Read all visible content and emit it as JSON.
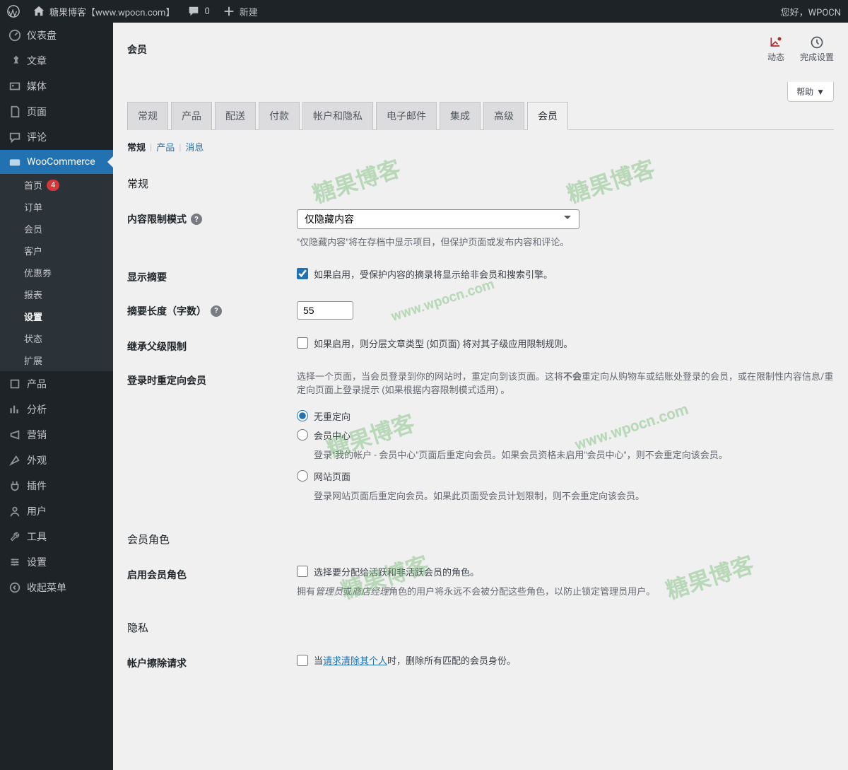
{
  "adminBar": {
    "siteName": "糖果博客【www.wpocn.com】",
    "commentCount": "0",
    "newLabel": "新建",
    "greeting": "您好，WPOCN"
  },
  "sidebar": {
    "items": [
      {
        "label": "仪表盘",
        "icon": "dashboard"
      },
      {
        "label": "文章",
        "icon": "pin"
      },
      {
        "label": "媒体",
        "icon": "media"
      },
      {
        "label": "页面",
        "icon": "page"
      },
      {
        "label": "评论",
        "icon": "comment"
      },
      {
        "label": "WooCommerce",
        "icon": "woo",
        "active": true
      },
      {
        "label": "产品",
        "icon": "product"
      },
      {
        "label": "分析",
        "icon": "analytics"
      },
      {
        "label": "营销",
        "icon": "marketing"
      },
      {
        "label": "外观",
        "icon": "appearance"
      },
      {
        "label": "插件",
        "icon": "plugins"
      },
      {
        "label": "用户",
        "icon": "users"
      },
      {
        "label": "工具",
        "icon": "tools"
      },
      {
        "label": "设置",
        "icon": "settings"
      },
      {
        "label": "收起菜单",
        "icon": "collapse"
      }
    ],
    "submenu": [
      {
        "label": "首页",
        "badge": "4"
      },
      {
        "label": "订单"
      },
      {
        "label": "会员"
      },
      {
        "label": "客户"
      },
      {
        "label": "优惠券"
      },
      {
        "label": "报表"
      },
      {
        "label": "设置",
        "current": true
      },
      {
        "label": "状态"
      },
      {
        "label": "扩展"
      }
    ]
  },
  "header": {
    "title": "会员",
    "actions": [
      {
        "label": "动态"
      },
      {
        "label": "完成设置"
      }
    ],
    "helpLabel": "帮助"
  },
  "tabs": [
    {
      "label": "常规"
    },
    {
      "label": "产品"
    },
    {
      "label": "配送"
    },
    {
      "label": "付款"
    },
    {
      "label": "帐户和隐私"
    },
    {
      "label": "电子邮件"
    },
    {
      "label": "集成"
    },
    {
      "label": "高级"
    },
    {
      "label": "会员",
      "active": true
    }
  ],
  "subtabs": [
    {
      "label": "常规",
      "active": true
    },
    {
      "label": "产品"
    },
    {
      "label": "消息"
    }
  ],
  "sections": {
    "general": {
      "title": "常规",
      "restrictMode": {
        "label": "内容限制模式",
        "value": "仅隐藏内容",
        "desc": "\"仅隐藏内容\"将在存档中显示项目，但保护页面或发布内容和评论。"
      },
      "showExcerpt": {
        "label": "显示摘要",
        "text": "如果启用，受保护内容的摘录将显示给非会员和搜索引擎。",
        "checked": true
      },
      "excerptLength": {
        "label": "摘要长度（字数）",
        "value": "55"
      },
      "inherit": {
        "label": "继承父级限制",
        "text": "如果启用，则分层文章类型 (如页面) 将对其子级应用限制规则。",
        "checked": false
      },
      "redirect": {
        "label": "登录时重定向会员",
        "intro1": "选择一个页面，当会员登录到你的网站时，重定向到该页面。这将",
        "introBold": "不会",
        "intro2": "重定向从购物车或结账处登录的会员，或在限制性内容信息/重定向页面上登录提示 (如果根据内容限制模式适用) 。",
        "options": [
          {
            "label": "无重定向",
            "checked": true
          },
          {
            "label": "会员中心",
            "desc": "登录\"我的帐户 - 会员中心\"页面后重定向会员。如果会员资格未启用\"会员中心\"，则不会重定向该会员。"
          },
          {
            "label": "网站页面",
            "desc": "登录网站页面后重定向会员。如果此页面受会员计划限制，则不会重定向该会员。"
          }
        ]
      }
    },
    "roles": {
      "title": "会员角色",
      "enable": {
        "label": "启用会员角色",
        "text": "选择要分配给活跃和非活跃会员的角色。",
        "desc1": "拥有",
        "descEm1": "管理员",
        "desc2": "或",
        "descEm2": "商店经理",
        "desc3": "角色的用户将永远不会被分配这些角色，以防止锁定管理员用户。",
        "checked": false
      }
    },
    "privacy": {
      "title": "隐私",
      "erasure": {
        "label": "帐户擦除请求",
        "text1": "当",
        "link": "请求清除其个人",
        "text2": "时，删除所有匹配的会员身份。",
        "checked": false
      }
    }
  },
  "watermarks": [
    "糖果博客",
    "www.wpocn.com",
    "糖果博客",
    "www.wpocn.com",
    "糖果博客",
    "www.wpocn.com",
    "糖果博客",
    "糖果博客"
  ]
}
